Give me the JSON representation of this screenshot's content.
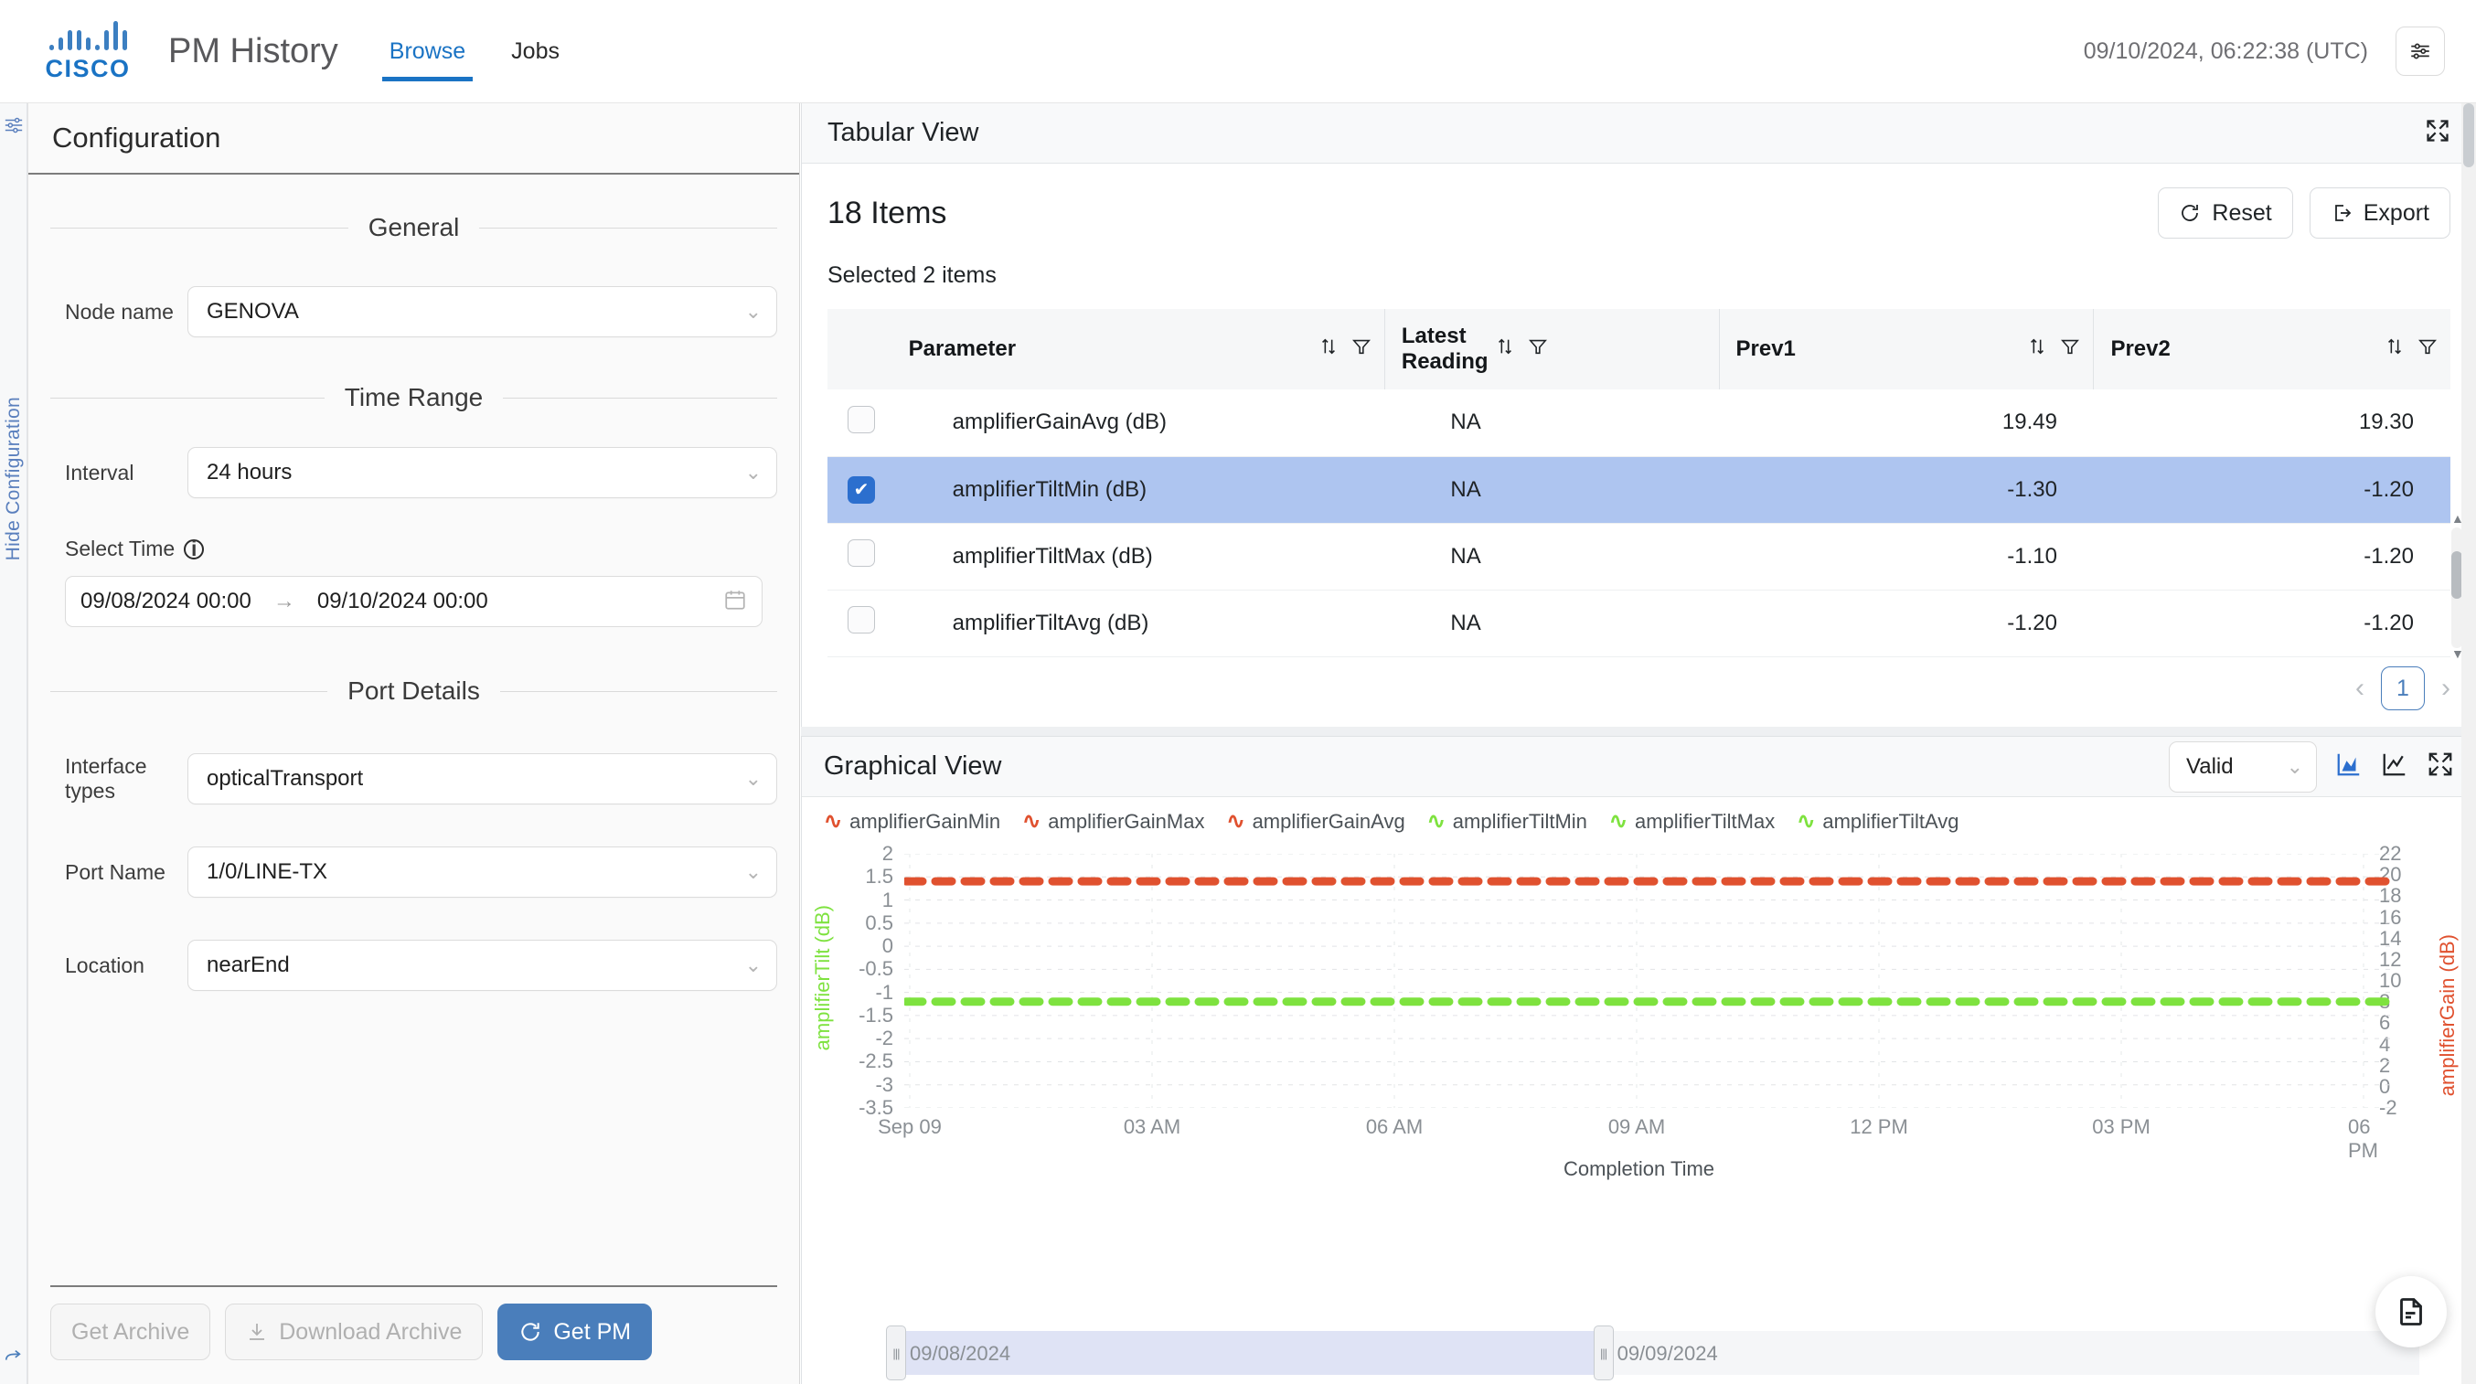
{
  "header": {
    "logo_name": "cisco-logo",
    "brand": "CISCO",
    "app_title": "PM History",
    "tabs": [
      {
        "label": "Browse",
        "active": true
      },
      {
        "label": "Jobs",
        "active": false
      }
    ],
    "clock": "09/10/2024, 06:22:38 (UTC)",
    "settings_icon": "sliders-icon"
  },
  "left_rail": {
    "icon": "sliders-icon",
    "toggle_label": "Hide Configuration"
  },
  "configuration": {
    "title": "Configuration",
    "sections": {
      "general": "General",
      "time_range": "Time Range",
      "port_details": "Port Details"
    },
    "fields": {
      "node_name": {
        "label": "Node name",
        "value": "GENOVA"
      },
      "interval": {
        "label": "Interval",
        "value": "24 hours"
      },
      "select_time": {
        "label": "Select Time",
        "start": "09/08/2024 00:00",
        "end": "09/10/2024 00:00",
        "arrow": "→"
      },
      "interface_types": {
        "label": "Interface types",
        "value": "opticalTransport"
      },
      "port_name": {
        "label": "Port Name",
        "value": "1/0/LINE-TX"
      },
      "location": {
        "label": "Location",
        "value": "nearEnd"
      }
    },
    "buttons": {
      "get_archive": "Get Archive",
      "download_archive": "Download Archive",
      "get_pm": "Get PM"
    }
  },
  "tabular": {
    "title": "Tabular View",
    "expand_icon": "expand-icon",
    "items_count": "18 Items",
    "reset": "Reset",
    "export": "Export",
    "selected_note": "Selected 2 items",
    "columns": [
      "Parameter",
      "Latest Reading",
      "Prev1",
      "Prev2"
    ],
    "rows": [
      {
        "selected": false,
        "parameter": "amplifierGainAvg (dB)",
        "latest": "NA",
        "prev1": "19.49",
        "prev2": "19.30"
      },
      {
        "selected": true,
        "parameter": "amplifierTiltMin (dB)",
        "latest": "NA",
        "prev1": "-1.30",
        "prev2": "-1.20"
      },
      {
        "selected": false,
        "parameter": "amplifierTiltMax (dB)",
        "latest": "NA",
        "prev1": "-1.10",
        "prev2": "-1.20"
      },
      {
        "selected": false,
        "parameter": "amplifierTiltAvg (dB)",
        "latest": "NA",
        "prev1": "-1.20",
        "prev2": "-1.20"
      }
    ],
    "pagination": {
      "prev": "‹",
      "page": "1",
      "next": "›"
    }
  },
  "graphical": {
    "title": "Graphical View",
    "filter_value": "Valid",
    "icons": [
      "area-chart-icon",
      "line-chart-icon",
      "expand-icon"
    ],
    "range_slider": {
      "start": "09/08/2024",
      "end": "09/09/2024"
    },
    "fab_icon": "document-icon"
  },
  "chart_data": {
    "type": "line",
    "title": "",
    "xlabel": "Completion Time",
    "y_left_label": "amplifierTilt (dB)",
    "y_right_label": "amplifierGain (dB)",
    "y_left_ticks": [
      "2",
      "1.5",
      "1",
      "0.5",
      "0",
      "-0.5",
      "-1",
      "-1.5",
      "-2",
      "-2.5",
      "-3",
      "-3.5"
    ],
    "y_right_ticks": [
      "22",
      "20",
      "18",
      "16",
      "14",
      "12",
      "10",
      "8",
      "6",
      "4",
      "2",
      "0",
      "-2"
    ],
    "ylim_left": [
      -3.5,
      2
    ],
    "ylim_right": [
      -2,
      22
    ],
    "x_ticks": [
      "Sep 09",
      "03 AM",
      "06 AM",
      "09 AM",
      "12 PM",
      "03 PM",
      "06 PM"
    ],
    "grid": true,
    "legend_position": "top",
    "legend": [
      {
        "name": "amplifierGainMin",
        "color": "#e0512f"
      },
      {
        "name": "amplifierGainMax",
        "color": "#e0512f"
      },
      {
        "name": "amplifierGainAvg",
        "color": "#e0512f"
      },
      {
        "name": "amplifierTiltMin",
        "color": "#7ee23f"
      },
      {
        "name": "amplifierTiltMax",
        "color": "#7ee23f"
      },
      {
        "name": "amplifierTiltAvg",
        "color": "#7ee23f"
      }
    ],
    "series": [
      {
        "name": "amplifierGain",
        "axis": "right",
        "color": "#e0512f",
        "style": "dashed",
        "constant_value": 19.4
      },
      {
        "name": "amplifierTilt",
        "axis": "left",
        "color": "#7ee23f",
        "style": "dashed",
        "constant_value": -1.2
      }
    ]
  }
}
